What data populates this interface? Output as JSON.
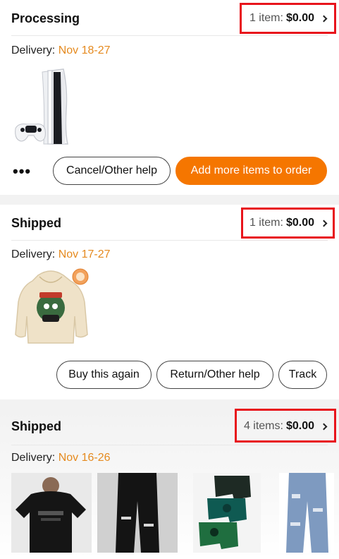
{
  "orders": [
    {
      "status": "Processing",
      "summary_count": "1 item:",
      "summary_price": "$0.00",
      "delivery_label": "Delivery:",
      "delivery_date": "Nov 18-27",
      "more_label": "•••",
      "buttons": [
        "Cancel/Other help",
        "Add more items to order"
      ],
      "images": [
        "game-console"
      ]
    },
    {
      "status": "Shipped",
      "summary_count": "1 item:",
      "summary_price": "$0.00",
      "delivery_label": "Delivery:",
      "delivery_date": "Nov 17-27",
      "buttons": [
        "Buy this again",
        "Return/Other help",
        "Track"
      ],
      "images": [
        "hoodie"
      ]
    },
    {
      "status": "Shipped",
      "summary_count": "4 items:",
      "summary_price": "$0.00",
      "delivery_label": "Delivery:",
      "delivery_date": "Nov 16-26",
      "images": [
        "black-tshirt",
        "black-ripped-jeans",
        "boxer-briefs",
        "blue-distressed-jeans"
      ]
    }
  ],
  "colors": {
    "accent": "#f57600",
    "delivery_date": "#e58a1f",
    "highlight_box": "#e8141c"
  }
}
